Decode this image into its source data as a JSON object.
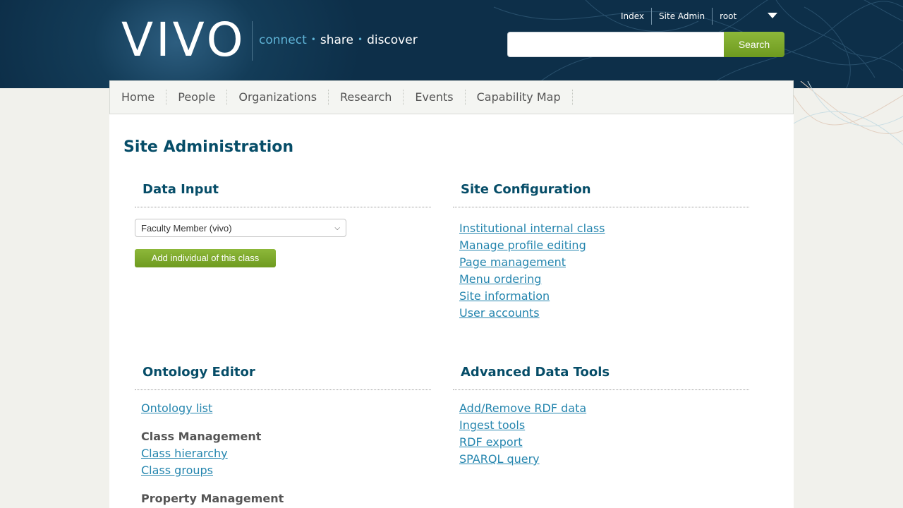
{
  "header": {
    "logo": "VIVO",
    "tagline": {
      "connect": "connect",
      "share": "share",
      "discover": "discover",
      "separator": "•"
    },
    "toplinks": {
      "index": "Index",
      "site_admin": "Site Admin",
      "user": "root"
    },
    "search": {
      "value": "",
      "placeholder": "",
      "button": "Search"
    }
  },
  "nav": {
    "items": [
      "Home",
      "People",
      "Organizations",
      "Research",
      "Events",
      "Capability Map"
    ]
  },
  "main": {
    "title": "Site Administration",
    "data_input": {
      "heading": "Data Input",
      "selected_class": "Faculty Member (vivo)",
      "add_button": "Add individual of this class"
    },
    "site_configuration": {
      "heading": "Site Configuration",
      "links": [
        "Institutional internal class",
        "Manage profile editing",
        "Page management",
        "Menu ordering",
        "Site information",
        "User accounts"
      ]
    },
    "ontology_editor": {
      "heading": "Ontology Editor",
      "ontology_list": "Ontology list",
      "class_management": "Class Management",
      "class_links": [
        "Class hierarchy",
        "Class groups"
      ],
      "property_management": "Property Management"
    },
    "advanced_data_tools": {
      "heading": "Advanced Data Tools",
      "links": [
        "Add/Remove RDF data",
        "Ingest tools",
        "RDF export",
        "SPARQL query"
      ]
    }
  },
  "colors": {
    "header_bg": "#0d2f49",
    "accent_green": "#7fab2c",
    "heading_blue": "#064d68",
    "link_blue": "#2485ae"
  }
}
